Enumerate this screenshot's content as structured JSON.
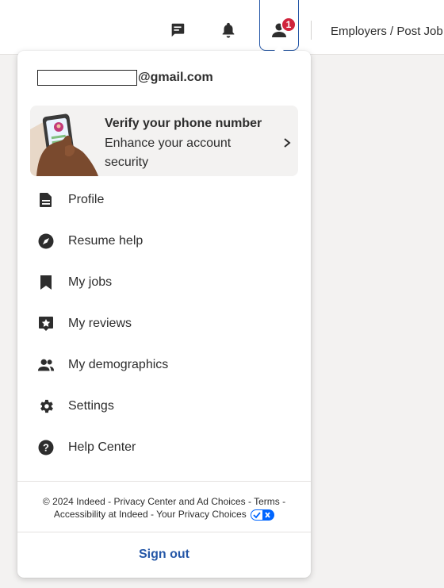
{
  "header": {
    "employers_link": "Employers / Post Job",
    "notification_count": "1",
    "icons": [
      "messages-icon",
      "notifications-icon",
      "profile-icon"
    ]
  },
  "account": {
    "email_domain": "@gmail.com"
  },
  "verify_card": {
    "title": "Verify your phone number",
    "subtitle": "Enhance your account security"
  },
  "menu": [
    {
      "label": "Profile",
      "icon": "document-icon"
    },
    {
      "label": "Resume help",
      "icon": "compass-icon"
    },
    {
      "label": "My jobs",
      "icon": "bookmark-icon"
    },
    {
      "label": "My reviews",
      "icon": "review-star-icon"
    },
    {
      "label": "My demographics",
      "icon": "people-icon"
    },
    {
      "label": "Settings",
      "icon": "gear-icon"
    },
    {
      "label": "Help Center",
      "icon": "help-icon"
    }
  ],
  "footer": {
    "copyright": "© 2024 Indeed",
    "sep": " - ",
    "privacy_center": "Privacy Center and Ad Choices",
    "terms": "Terms",
    "accessibility": "Accessibility at Indeed",
    "privacy_choices": "Your Privacy Choices"
  },
  "sign_out": "Sign out",
  "colors": {
    "accent": "#2557a7",
    "badge": "#d0243c",
    "text": "#2d2d2d",
    "card_bg": "#f3f2f1"
  }
}
